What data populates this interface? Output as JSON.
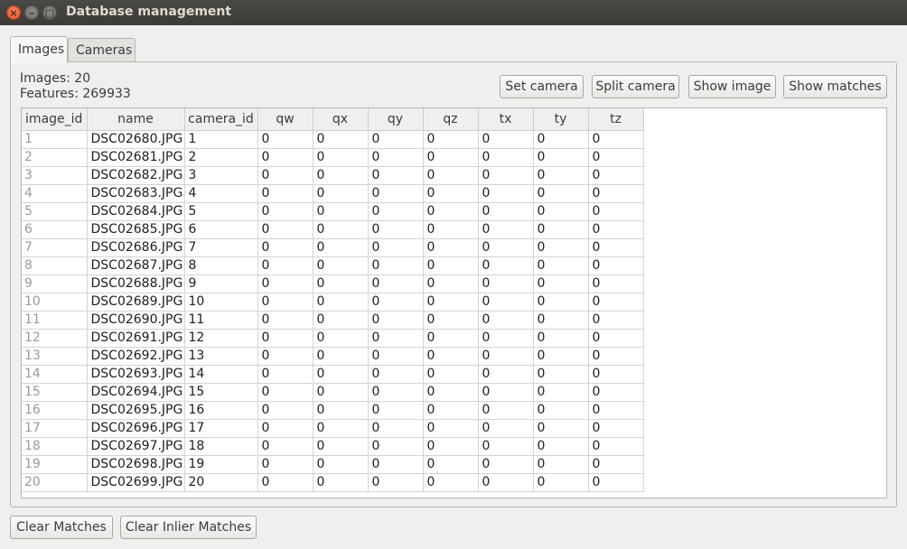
{
  "window": {
    "title": "Database management",
    "controls": {
      "close": "×",
      "minimize": "–",
      "maximize": "□"
    }
  },
  "tabs": [
    {
      "label": "Images",
      "active": true
    },
    {
      "label": "Cameras",
      "active": false
    }
  ],
  "info": {
    "images_label": "Images: 20",
    "features_label": "Features: 269933"
  },
  "toolbar": {
    "set_camera": "Set camera",
    "split_camera": "Split camera",
    "show_image": "Show image",
    "show_matches": "Show matches"
  },
  "table": {
    "columns": [
      "image_id",
      "name",
      "camera_id",
      "qw",
      "qx",
      "qy",
      "qz",
      "tx",
      "ty",
      "tz"
    ],
    "rows": [
      [
        "1",
        "DSC02680.JPG",
        "1",
        "0",
        "0",
        "0",
        "0",
        "0",
        "0",
        "0"
      ],
      [
        "2",
        "DSC02681.JPG",
        "2",
        "0",
        "0",
        "0",
        "0",
        "0",
        "0",
        "0"
      ],
      [
        "3",
        "DSC02682.JPG",
        "3",
        "0",
        "0",
        "0",
        "0",
        "0",
        "0",
        "0"
      ],
      [
        "4",
        "DSC02683.JPG",
        "4",
        "0",
        "0",
        "0",
        "0",
        "0",
        "0",
        "0"
      ],
      [
        "5",
        "DSC02684.JPG",
        "5",
        "0",
        "0",
        "0",
        "0",
        "0",
        "0",
        "0"
      ],
      [
        "6",
        "DSC02685.JPG",
        "6",
        "0",
        "0",
        "0",
        "0",
        "0",
        "0",
        "0"
      ],
      [
        "7",
        "DSC02686.JPG",
        "7",
        "0",
        "0",
        "0",
        "0",
        "0",
        "0",
        "0"
      ],
      [
        "8",
        "DSC02687.JPG",
        "8",
        "0",
        "0",
        "0",
        "0",
        "0",
        "0",
        "0"
      ],
      [
        "9",
        "DSC02688.JPG",
        "9",
        "0",
        "0",
        "0",
        "0",
        "0",
        "0",
        "0"
      ],
      [
        "10",
        "DSC02689.JPG",
        "10",
        "0",
        "0",
        "0",
        "0",
        "0",
        "0",
        "0"
      ],
      [
        "11",
        "DSC02690.JPG",
        "11",
        "0",
        "0",
        "0",
        "0",
        "0",
        "0",
        "0"
      ],
      [
        "12",
        "DSC02691.JPG",
        "12",
        "0",
        "0",
        "0",
        "0",
        "0",
        "0",
        "0"
      ],
      [
        "13",
        "DSC02692.JPG",
        "13",
        "0",
        "0",
        "0",
        "0",
        "0",
        "0",
        "0"
      ],
      [
        "14",
        "DSC02693.JPG",
        "14",
        "0",
        "0",
        "0",
        "0",
        "0",
        "0",
        "0"
      ],
      [
        "15",
        "DSC02694.JPG",
        "15",
        "0",
        "0",
        "0",
        "0",
        "0",
        "0",
        "0"
      ],
      [
        "16",
        "DSC02695.JPG",
        "16",
        "0",
        "0",
        "0",
        "0",
        "0",
        "0",
        "0"
      ],
      [
        "17",
        "DSC02696.JPG",
        "17",
        "0",
        "0",
        "0",
        "0",
        "0",
        "0",
        "0"
      ],
      [
        "18",
        "DSC02697.JPG",
        "18",
        "0",
        "0",
        "0",
        "0",
        "0",
        "0",
        "0"
      ],
      [
        "19",
        "DSC02698.JPG",
        "19",
        "0",
        "0",
        "0",
        "0",
        "0",
        "0",
        "0"
      ],
      [
        "20",
        "DSC02699.JPG",
        "20",
        "0",
        "0",
        "0",
        "0",
        "0",
        "0",
        "0"
      ]
    ]
  },
  "bottom": {
    "clear_matches": "Clear Matches",
    "clear_inlier_matches": "Clear Inlier Matches"
  }
}
